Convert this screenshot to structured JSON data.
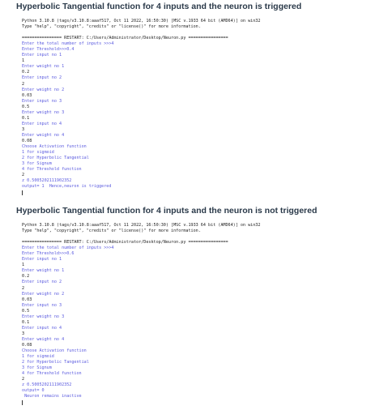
{
  "sections": [
    {
      "title": "Hyperbolic Tangential function for 4 inputs and the neuron is triggered",
      "lines": [
        {
          "text": "Python 3.10.8 (tags/v3.10.8:aaaf517, Oct 11 2022, 16:50:30) [MSC v.1933 64 bit (AMD64)] on win32",
          "kind": "output"
        },
        {
          "text": "Type \"help\", \"copyright\", \"credits\" or \"license()\" for more information.",
          "kind": "output"
        },
        {
          "text": "",
          "kind": "output"
        },
        {
          "text": "================ RESTART: C:/Users/Administrator/Desktop/Neuron.py ================",
          "kind": "output"
        },
        {
          "text": "Enter the total number of inputs >>>4",
          "kind": "prompt"
        },
        {
          "text": "Enter Threshold>>>0.4",
          "kind": "prompt"
        },
        {
          "text": "Enter input no 1",
          "kind": "prompt"
        },
        {
          "text": "1",
          "kind": "input"
        },
        {
          "text": "Enter weight no 1",
          "kind": "prompt"
        },
        {
          "text": "0.2",
          "kind": "input"
        },
        {
          "text": "Enter input no 2",
          "kind": "prompt"
        },
        {
          "text": "2",
          "kind": "input"
        },
        {
          "text": "Enter weight no 2",
          "kind": "prompt"
        },
        {
          "text": "0.03",
          "kind": "input"
        },
        {
          "text": "Enter input no 3",
          "kind": "prompt"
        },
        {
          "text": "0.5",
          "kind": "input"
        },
        {
          "text": "Enter weight no 3",
          "kind": "prompt"
        },
        {
          "text": "0.1",
          "kind": "input"
        },
        {
          "text": "Enter input no 4",
          "kind": "prompt"
        },
        {
          "text": "3",
          "kind": "input"
        },
        {
          "text": "Enter weight no 4",
          "kind": "prompt"
        },
        {
          "text": "0.08",
          "kind": "input"
        },
        {
          "text": "Choose Activation function",
          "kind": "prompt"
        },
        {
          "text": "1 for sigmoid",
          "kind": "prompt"
        },
        {
          "text": "2 for Hyperbolic Tangential",
          "kind": "prompt"
        },
        {
          "text": "3 for Signum",
          "kind": "prompt"
        },
        {
          "text": "4 for Threshold function",
          "kind": "prompt"
        },
        {
          "text": "2",
          "kind": "input"
        },
        {
          "text": "z 0.5005202111902352",
          "kind": "prompt"
        },
        {
          "text": "output= 1  Hence,neuron is triggered",
          "kind": "prompt"
        }
      ]
    },
    {
      "title": "Hyperbolic Tangential function for 4 inputs and the neuron is not triggered",
      "lines": [
        {
          "text": "Python 3.10.8 (tags/v3.10.8:aaaf517, Oct 11 2022, 16:50:30) [MSC v.1933 64 bit (AMD64)] on win32",
          "kind": "output"
        },
        {
          "text": "Type \"help\", \"copyright\", \"credits\" or \"license()\" for more information.",
          "kind": "output"
        },
        {
          "text": "",
          "kind": "output"
        },
        {
          "text": "================ RESTART: C:/Users/Administrator/Desktop/Neuron.py ================",
          "kind": "output"
        },
        {
          "text": "Enter the total number of inputs >>>4",
          "kind": "prompt"
        },
        {
          "text": "Enter Threshold>>>0.6",
          "kind": "prompt"
        },
        {
          "text": "Enter input no 1",
          "kind": "prompt"
        },
        {
          "text": "1",
          "kind": "input"
        },
        {
          "text": "Enter weight no 1",
          "kind": "prompt"
        },
        {
          "text": "0.2",
          "kind": "input"
        },
        {
          "text": "Enter input no 2",
          "kind": "prompt"
        },
        {
          "text": "2",
          "kind": "input"
        },
        {
          "text": "Enter weight no 2",
          "kind": "prompt"
        },
        {
          "text": "0.03",
          "kind": "input"
        },
        {
          "text": "Enter input no 3",
          "kind": "prompt"
        },
        {
          "text": "0.5",
          "kind": "input"
        },
        {
          "text": "Enter weight no 3",
          "kind": "prompt"
        },
        {
          "text": "0.1",
          "kind": "input"
        },
        {
          "text": "Enter input no 4",
          "kind": "prompt"
        },
        {
          "text": "3",
          "kind": "input"
        },
        {
          "text": "Enter weight no 4",
          "kind": "prompt"
        },
        {
          "text": "0.08",
          "kind": "input"
        },
        {
          "text": "Choose Activation function",
          "kind": "prompt"
        },
        {
          "text": "1 for sigmoid",
          "kind": "prompt"
        },
        {
          "text": "2 for Hyperbolic Tangential",
          "kind": "prompt"
        },
        {
          "text": "3 for Signum",
          "kind": "prompt"
        },
        {
          "text": "4 for Threshold function",
          "kind": "prompt"
        },
        {
          "text": "2",
          "kind": "input"
        },
        {
          "text": "z 0.5005202111902352",
          "kind": "prompt"
        },
        {
          "text": "output= 0",
          "kind": "prompt"
        },
        {
          "text": " Neuron remains inactive",
          "kind": "prompt"
        }
      ]
    }
  ],
  "colors": {
    "heading": "#2b3a4a",
    "output": "#1e1e1e",
    "prompt": "#5a5adf",
    "input": "#1e1e1e"
  }
}
